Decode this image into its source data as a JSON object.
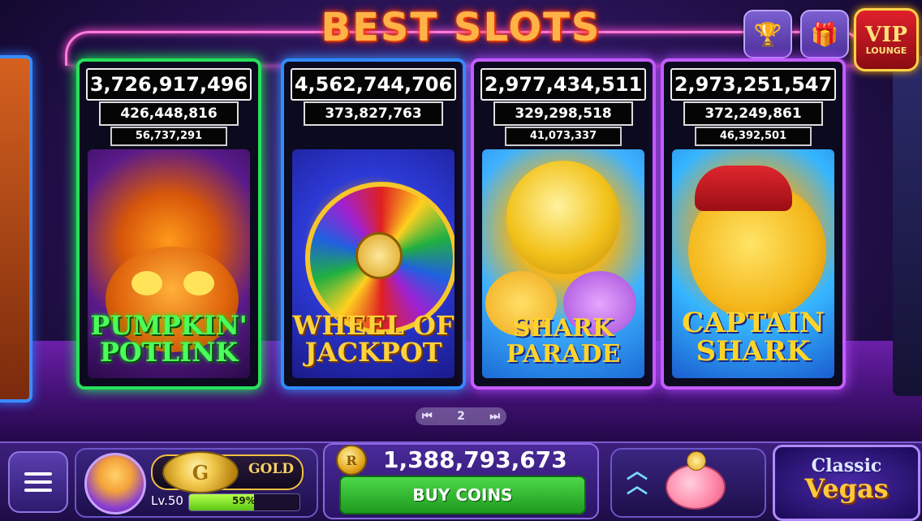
{
  "header": {
    "title": "BEST SLOTS",
    "trophy_icon": "trophy-icon",
    "gift_icon": "gift-icon",
    "vip_line1": "VIP",
    "vip_line2": "LOUNGE"
  },
  "machines": [
    {
      "jackpot_grand": "3,726,917,496",
      "jackpot_major": "426,448,816",
      "jackpot_minor": "56,737,291",
      "title_line1": "PUMPKIN'",
      "title_line2": "POTLINK"
    },
    {
      "jackpot_grand": "4,562,744,706",
      "jackpot_major": "373,827,763",
      "jackpot_minor": "",
      "title_line1": "WHEEL OF",
      "title_line2": "JACKPOT"
    },
    {
      "jackpot_grand": "2,977,434,511",
      "jackpot_major": "329,298,518",
      "jackpot_minor": "41,073,337",
      "title_line1": "SHARK",
      "title_line2": "PARADE"
    },
    {
      "jackpot_grand": "2,973,251,547",
      "jackpot_major": "372,249,861",
      "jackpot_minor": "46,392,501",
      "title_line1": "CAPTAIN",
      "title_line2": "SHARK"
    }
  ],
  "pager": {
    "page": "2",
    "prev_icon": "skip-back-icon",
    "next_icon": "skip-forward-icon"
  },
  "bottom_bar": {
    "menu_icon": "hamburger-menu-icon",
    "gold_coin_letter": "G",
    "gold_label": "GOLD",
    "level": "Lv.50",
    "xp_percent": "59%",
    "xp_fraction": 0.59,
    "coin_symbol": "R",
    "coins": "1,388,793,673",
    "buy_label": "BUY COINS",
    "up_icon": "double-chevron-up-icon",
    "piggy_icon": "piggy-bank-icon",
    "classic_line1": "Classic",
    "classic_line2": "Vegas"
  },
  "colors": {
    "title": "#ffb347",
    "machine1_border": "#27e05a",
    "machine2_border": "#2f8cff",
    "machine3_border": "#c45cff",
    "buy_button": "#2fb82e"
  }
}
